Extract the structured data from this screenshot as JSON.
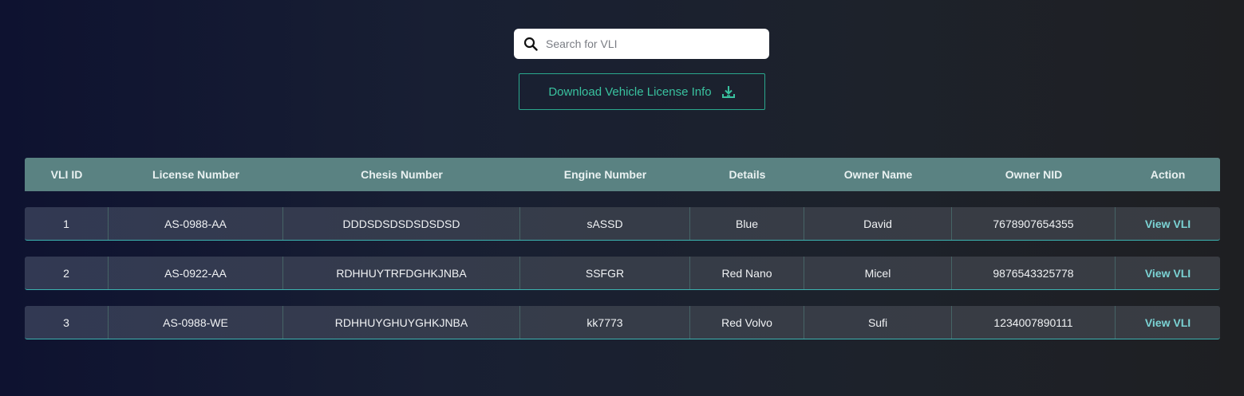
{
  "search": {
    "placeholder": "Search for VLI",
    "value": ""
  },
  "download": {
    "label": "Download Vehicle License Info"
  },
  "table": {
    "columns": [
      "VLI ID",
      "License Number",
      "Chesis Number",
      "Engine Number",
      "Details",
      "Owner Name",
      "Owner NID",
      "Action"
    ],
    "rows": [
      {
        "id": "1",
        "license": "AS-0988-AA",
        "chesis": "DDDSDSDSDSDSDSD",
        "engine": "sASSD",
        "details": "Blue",
        "owner": "David",
        "nid": "7678907654355",
        "action": "View VLI"
      },
      {
        "id": "2",
        "license": "AS-0922-AA",
        "chesis": "RDHHUYTRFDGHKJNBA",
        "engine": "SSFGR",
        "details": "Red Nano",
        "owner": "Micel",
        "nid": "9876543325778",
        "action": "View VLI"
      },
      {
        "id": "3",
        "license": "AS-0988-WE",
        "chesis": "RDHHUYGHUYGHKJNBA",
        "engine": "kk7773",
        "details": "Red Volvo",
        "owner": "Sufi",
        "nid": "1234007890111",
        "action": "View VLI"
      }
    ]
  },
  "colors": {
    "accent": "#39c29f",
    "header_bg": "#5a8282",
    "link": "#7bd3d4"
  },
  "icons": {
    "search": "search-icon",
    "download": "download-icon"
  }
}
